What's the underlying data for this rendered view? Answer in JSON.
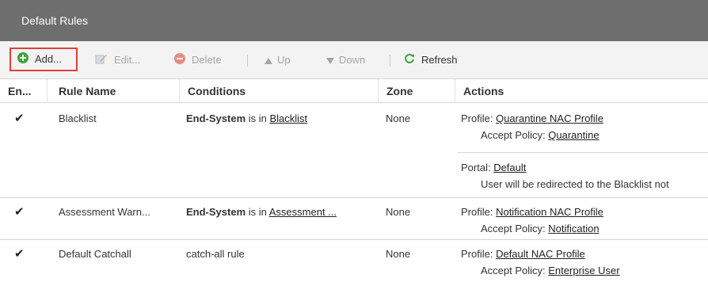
{
  "panel": {
    "title": "Default Rules"
  },
  "toolbar": {
    "add": "Add...",
    "edit": "Edit...",
    "delete": "Delete",
    "up": "Up",
    "down": "Down",
    "refresh": "Refresh"
  },
  "columns": [
    "En...",
    "Rule Name",
    "Conditions",
    "Zone",
    "Actions"
  ],
  "rows": [
    {
      "enabled": "✔",
      "name": "Blacklist",
      "cond_bold": "End-System",
      "cond_mid": " is in ",
      "cond_link": "Blacklist",
      "zone": "None",
      "a1_label": "Profile: ",
      "a1_link": "Quarantine NAC Profile",
      "a2_label": "Accept Policy: ",
      "a2_link": "Quarantine",
      "a3_label": "Portal: ",
      "a3_link": "Default",
      "a4_text": "User will be redirected to the Blacklist not"
    },
    {
      "enabled": "✔",
      "name": "Assessment Warn...",
      "cond_bold": "End-System",
      "cond_mid": " is in ",
      "cond_link": "Assessment ...",
      "zone": "None",
      "a1_label": "Profile: ",
      "a1_link": "Notification NAC Profile",
      "a2_label": "Accept Policy: ",
      "a2_link": "Notification"
    },
    {
      "enabled": "✔",
      "name": "Default Catchall",
      "cond_text": "catch-all rule",
      "zone": "None",
      "a1_label": "Profile: ",
      "a1_link": "Default NAC Profile",
      "a2_label": "Accept Policy: ",
      "a2_link": "Enterprise User"
    }
  ],
  "colors": {
    "titlebar": "#6e6e6e",
    "add_icon": "#3aa63a",
    "delete_icon": "#e25c4f",
    "refresh_icon": "#3aa63a",
    "highlight": "#e0403a"
  }
}
